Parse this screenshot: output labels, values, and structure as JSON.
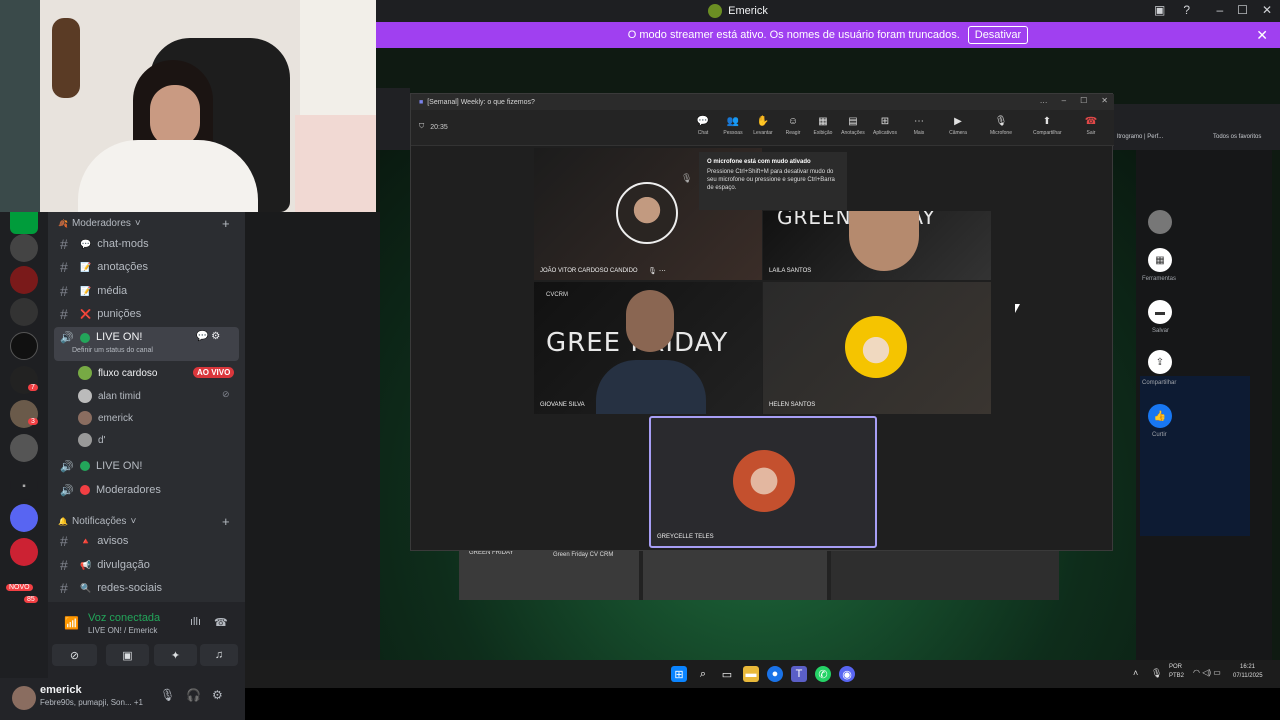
{
  "titlebar": {
    "title": "Emerick"
  },
  "streamer": {
    "message": "O modo streamer está ativo. Os nomes de usuário foram truncados.",
    "button": "Desativar"
  },
  "channels": {
    "category_mods": "Moderadores",
    "category_notif": "Notificações",
    "items": [
      {
        "name": "chat-mods",
        "emoji": "💬"
      },
      {
        "name": "anotações",
        "emoji": "📝"
      },
      {
        "name": "média",
        "emoji": "📝"
      },
      {
        "name": "punições",
        "emoji": "❌"
      }
    ],
    "live_channel": "LIVE ON!",
    "live_status": "Definir um status do canal",
    "voice_users": [
      {
        "name": "fluxo cardoso",
        "badge": "AO VIVO"
      },
      {
        "name": "alan timid"
      },
      {
        "name": "emerick"
      },
      {
        "name": "d'"
      }
    ],
    "voice2": "LIVE ON!",
    "voice3": "Moderadores",
    "notif_items": [
      {
        "name": "avisos",
        "emoji": "🔺"
      },
      {
        "name": "divulgação",
        "emoji": "📢"
      },
      {
        "name": "redes-sociais",
        "emoji": "🔍"
      }
    ]
  },
  "rail": {
    "badge_7": "7",
    "badge_3": "3",
    "new_label": "NOVO",
    "badge_85": "85"
  },
  "voice": {
    "title": "Voz conectada",
    "sub": "LIVE ON! / Emerick"
  },
  "user": {
    "name": "emerick",
    "status": "Febre90s, pumapji, Son...",
    "extra": "+1"
  },
  "teams": {
    "title": "[Semanal] Weekly: o que fizemos?",
    "timer": "20:35",
    "tools": [
      "Chat",
      "Pessoas",
      "Levantar",
      "Reagir",
      "Exibição",
      "Anotações",
      "Aplicativos",
      "Mais",
      "Câmera",
      "Microfone",
      "Compartilhar",
      "Sair"
    ],
    "notice_title": "O microfone está com mudo ativado",
    "notice_body": "Pressione Ctrl+Shift+M para desativar mudo do seu microfone ou pressione e segure Ctrl+Barra de espaço.",
    "participants": [
      "JOÃO VITOR CARDOSO CANDIDO",
      "LAILA SANTOS",
      "GIOVANE SILVA",
      "HELEN SANTOS",
      "GREYCELLE TELES"
    ],
    "green_friday_left": "GREE FRIDAY",
    "green_friday_right": "GREEN FRIDAY",
    "cvcrm": "CVCRM"
  },
  "browser": {
    "tab1": "Todos os favoritos",
    "tab2": "ltrogramo | Perf...",
    "side": [
      "Ferramentas",
      "Salvar",
      "Compartilhar",
      "Curtir"
    ]
  },
  "promo": {
    "title1": "GREEN FRIDAY",
    "sub1": "Green Friday CV CRM"
  },
  "taskbar": {
    "lang1": "POR",
    "lang2": "PTB2",
    "time": "16:21",
    "date": "07/11/2025"
  },
  "colors": {
    "streamer": "#a040f0",
    "discord_bg": "#2b2d31",
    "live_red": "#da373c",
    "voice_green": "#23a55a"
  }
}
